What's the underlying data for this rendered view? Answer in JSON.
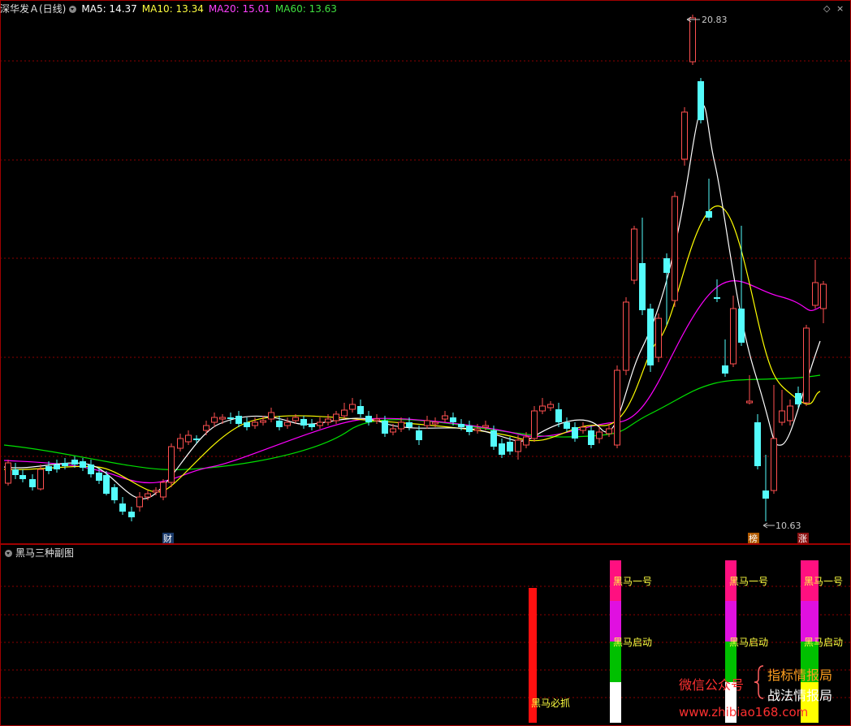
{
  "header": {
    "title": "深华发Ａ(日线)",
    "ma5": "MA5: 14.37",
    "ma10": "MA10: 13.34",
    "ma20": "MA20: 15.01",
    "ma60": "MA60: 13.63",
    "corner_icons": [
      "diamond-icon",
      "close-icon"
    ]
  },
  "price_panel": {
    "high_label": "20.83",
    "low_label": "10.63",
    "badges": [
      "财",
      "榜",
      "涨"
    ]
  },
  "indicator_panel": {
    "title": "黑马三种副图",
    "labels": {
      "signal_red": "黑马必抓",
      "bar1_top": "黑马一号",
      "bar1_mid": "黑马启动",
      "bar2_top": "黑马一号",
      "bar2_mid": "黑马启动",
      "bar3_top": "黑马一号",
      "bar3_mid": "黑马启动"
    }
  },
  "watermark": {
    "line_left": "微信公众号",
    "line1": "指标情报局",
    "line2": "战法情报局",
    "url": "www.zhibiao168.com"
  },
  "colors": {
    "up": "#ff5050",
    "down": "#54fcfc",
    "ma5": "#ffffff",
    "ma10": "#ffff00",
    "ma20": "#ff00ff",
    "ma60": "#00e000",
    "grid": "#8b0000"
  }
}
